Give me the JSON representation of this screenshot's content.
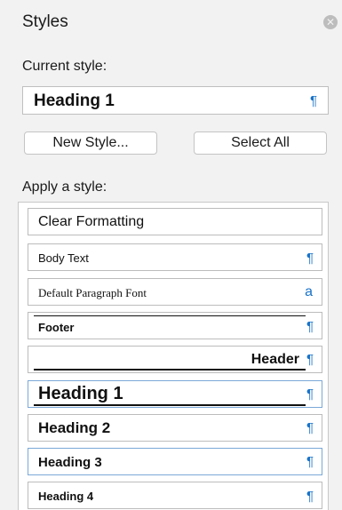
{
  "panel": {
    "title": "Styles",
    "close_icon": "close-icon"
  },
  "current_style": {
    "label": "Current style:",
    "value": "Heading 1",
    "mark": "¶"
  },
  "buttons": {
    "new_style": "New Style...",
    "select_all": "Select All"
  },
  "apply": {
    "label": "Apply a style:",
    "items": [
      {
        "name": "Clear Formatting",
        "mark": ""
      },
      {
        "name": "Body Text",
        "mark": "¶"
      },
      {
        "name": "Default Paragraph Font",
        "mark": "a"
      },
      {
        "name": "Footer",
        "mark": "¶"
      },
      {
        "name": "Header",
        "mark": "¶"
      },
      {
        "name": "Heading 1",
        "mark": "¶"
      },
      {
        "name": "Heading 2",
        "mark": "¶"
      },
      {
        "name": "Heading 3",
        "mark": "¶"
      },
      {
        "name": "Heading 4",
        "mark": "¶"
      }
    ]
  },
  "colors": {
    "accent": "#1a73c8",
    "selected_border": "#7aa8d8"
  }
}
